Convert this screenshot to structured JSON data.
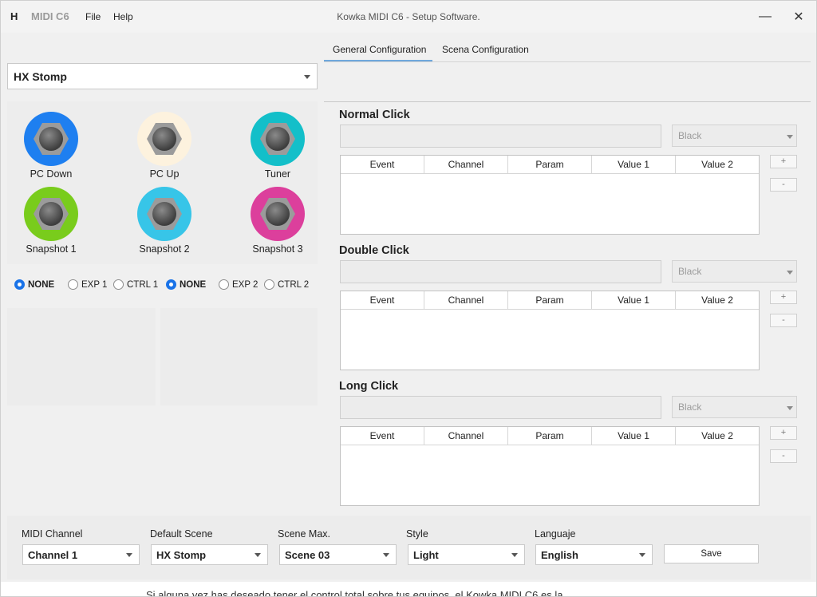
{
  "titlebar": {
    "logo": "H",
    "app_name": "MIDI C6",
    "menu": [
      "File",
      "Help"
    ],
    "window_title": "Kowka MIDI C6 - Setup Software.",
    "minimize": "—",
    "close": "✕"
  },
  "device": {
    "selected": "HX Stomp"
  },
  "footswitches": [
    {
      "label": "PC Down",
      "color": "#1e7ff0"
    },
    {
      "label": "PC Up",
      "color": "#fdf2de"
    },
    {
      "label": "Tuner",
      "color": "#13bfc9"
    },
    {
      "label": "Snapshot 1",
      "color": "#79cc1c"
    },
    {
      "label": "Snapshot 2",
      "color": "#37c5e8"
    },
    {
      "label": "Snapshot 3",
      "color": "#dc3f9c"
    }
  ],
  "expression": {
    "group1": [
      {
        "label": "NONE",
        "selected": true
      },
      {
        "label": "EXP 1",
        "selected": false
      },
      {
        "label": "CTRL 1",
        "selected": false
      }
    ],
    "group2": [
      {
        "label": "NONE",
        "selected": true
      },
      {
        "label": "EXP 2",
        "selected": false
      },
      {
        "label": "CTRL 2",
        "selected": false
      }
    ]
  },
  "tabs": [
    {
      "label": "General Configuration",
      "active": true
    },
    {
      "label": "Scena Configuration",
      "active": false
    }
  ],
  "sections": [
    {
      "title": "Normal Click",
      "color": "Black",
      "columns": [
        "Event",
        "Channel",
        "Param",
        "Value 1",
        "Value 2"
      ],
      "add": "+",
      "remove": "-"
    },
    {
      "title": "Double Click",
      "color": "Black",
      "columns": [
        "Event",
        "Channel",
        "Param",
        "Value 1",
        "Value 2"
      ],
      "add": "+",
      "remove": "-"
    },
    {
      "title": "Long Click",
      "color": "Black",
      "columns": [
        "Event",
        "Channel",
        "Param",
        "Value 1",
        "Value 2"
      ],
      "add": "+",
      "remove": "-"
    }
  ],
  "bottom": {
    "midi_channel": {
      "label": "MIDI Channel",
      "value": "Channel 1"
    },
    "default_scene": {
      "label": "Default Scene",
      "value": "HX Stomp"
    },
    "scene_max": {
      "label": "Scene Max.",
      "value": "Scene 03"
    },
    "style": {
      "label": "Style",
      "value": "Light"
    },
    "language": {
      "label": "Languaje",
      "value": "English"
    },
    "save": "Save"
  },
  "background_text": "Si alguna vez has deseado tener el control total sobre tus equipos, el Kowka MIDI C6 es la"
}
